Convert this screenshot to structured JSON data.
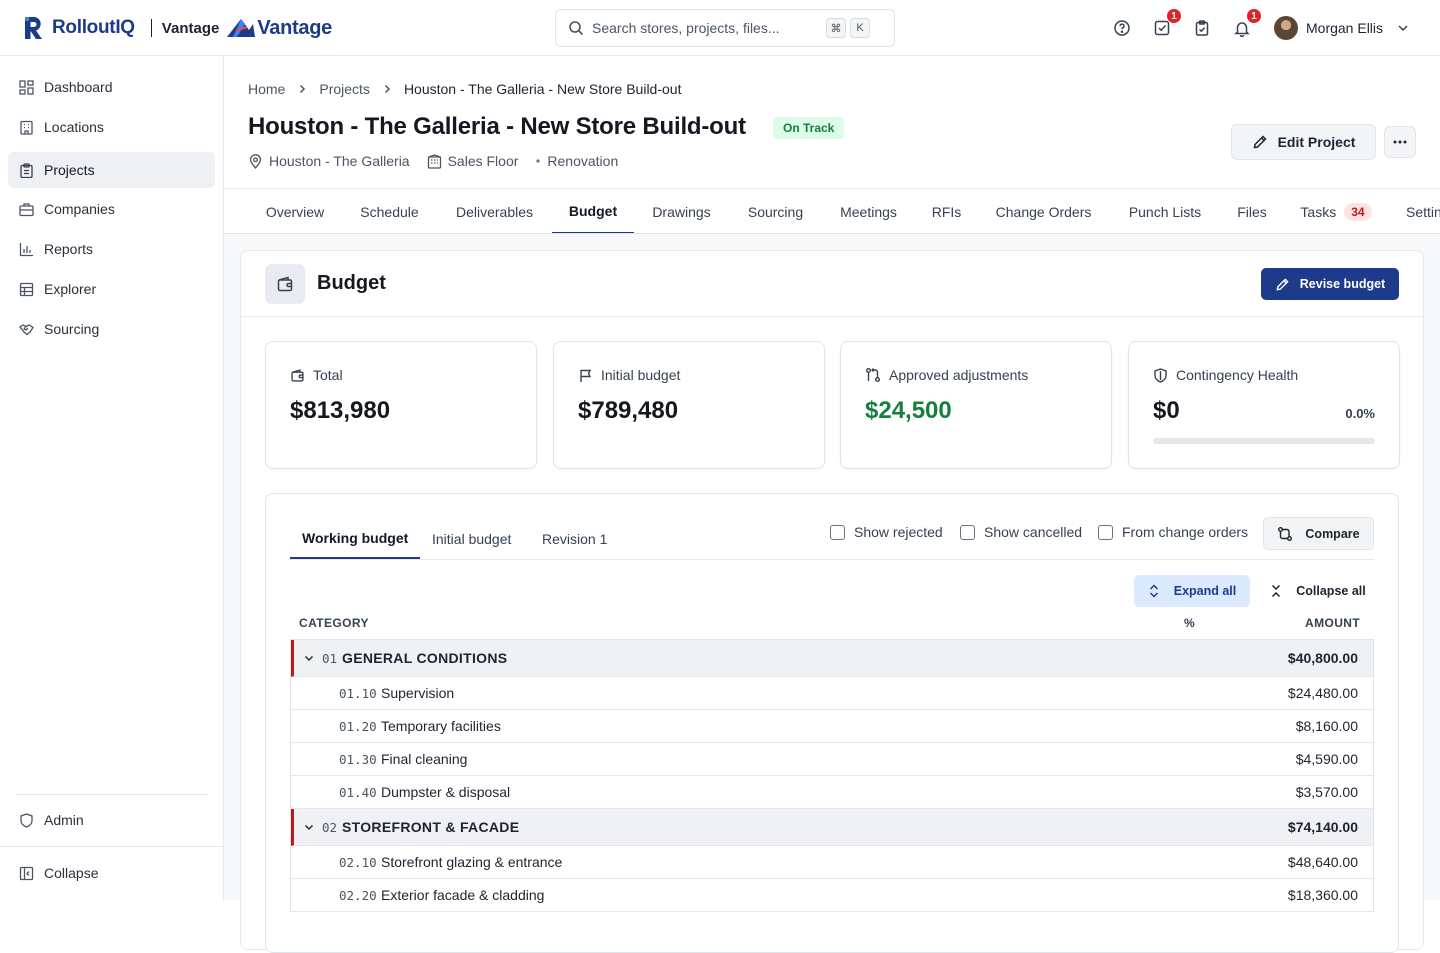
{
  "header": {
    "brand": "RolloutIQ",
    "partner_text": "Vantage",
    "partner_logo_text": "Vantage",
    "search_placeholder": "Search stores, projects, files...",
    "shortcut_keys": [
      "⌘",
      "K"
    ],
    "tasks_badge": "1",
    "notifications_badge": "1",
    "user_name": "Morgan Ellis"
  },
  "sidebar": {
    "items": [
      {
        "label": "Dashboard",
        "icon": "dashboard-icon"
      },
      {
        "label": "Locations",
        "icon": "building-icon"
      },
      {
        "label": "Projects",
        "icon": "clipboard-icon",
        "active": true
      },
      {
        "label": "Companies",
        "icon": "briefcase-icon"
      },
      {
        "label": "Reports",
        "icon": "bar-chart-icon"
      },
      {
        "label": "Explorer",
        "icon": "table-icon"
      },
      {
        "label": "Sourcing",
        "icon": "handshake-icon"
      }
    ],
    "admin_label": "Admin",
    "collapse_label": "Collapse"
  },
  "breadcrumb": [
    "Home",
    "Projects",
    "Houston - The Galleria - New Store Build-out"
  ],
  "project": {
    "title": "Houston - The Galleria - New Store Build-out",
    "status": "On Track",
    "location": "Houston - The Galleria",
    "area": "Sales Floor",
    "type": "Renovation",
    "edit_label": "Edit Project"
  },
  "tabs": [
    {
      "label": "Overview"
    },
    {
      "label": "Schedule"
    },
    {
      "label": "Deliverables"
    },
    {
      "label": "Budget",
      "active": true
    },
    {
      "label": "Drawings"
    },
    {
      "label": "Sourcing"
    },
    {
      "label": "Meetings"
    },
    {
      "label": "RFIs"
    },
    {
      "label": "Change Orders"
    },
    {
      "label": "Punch Lists"
    },
    {
      "label": "Files"
    },
    {
      "label": "Tasks",
      "count": "34"
    },
    {
      "label": "Settings"
    }
  ],
  "budget": {
    "title": "Budget",
    "revise_label": "Revise budget",
    "stats": {
      "total": {
        "label": "Total",
        "value": "$813,980"
      },
      "initial": {
        "label": "Initial budget",
        "value": "$789,480"
      },
      "adjustments": {
        "label": "Approved adjustments",
        "value": "$24,500"
      },
      "contingency": {
        "label": "Contingency Health",
        "value": "$0",
        "percent": "0.0%",
        "fill_fraction": 0
      }
    },
    "subtabs": [
      "Working budget",
      "Initial budget",
      "Revision 1"
    ],
    "filters": [
      "Show rejected",
      "Show cancelled",
      "From change orders"
    ],
    "compare_label": "Compare",
    "expand_label": "Expand all",
    "collapse_label": "Collapse all",
    "columns": {
      "category": "CATEGORY",
      "percent": "%",
      "amount": "AMOUNT"
    },
    "rows": [
      {
        "kind": "group",
        "code": "01",
        "label": "GENERAL CONDITIONS",
        "amount": "$40,800.00"
      },
      {
        "kind": "item",
        "code": "01.10",
        "label": "Supervision",
        "amount": "$24,480.00"
      },
      {
        "kind": "item",
        "code": "01.20",
        "label": "Temporary facilities",
        "amount": "$8,160.00"
      },
      {
        "kind": "item",
        "code": "01.30",
        "label": "Final cleaning",
        "amount": "$4,590.00"
      },
      {
        "kind": "item",
        "code": "01.40",
        "label": "Dumpster & disposal",
        "amount": "$3,570.00"
      },
      {
        "kind": "group",
        "code": "02",
        "label": "STOREFRONT & FACADE",
        "amount": "$74,140.00"
      },
      {
        "kind": "item",
        "code": "02.10",
        "label": "Storefront glazing & entrance",
        "amount": "$48,640.00"
      },
      {
        "kind": "item",
        "code": "02.20",
        "label": "Exterior facade & cladding",
        "amount": "$18,360.00"
      }
    ]
  },
  "colors": {
    "accent": "#1e3a8a",
    "success": "#15803d",
    "danger": "#b91c1c"
  }
}
